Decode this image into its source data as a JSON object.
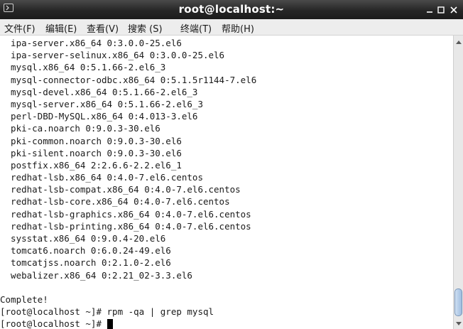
{
  "window": {
    "title": "root@localhost:~",
    "buttons": [
      "minimize",
      "maximize",
      "close"
    ]
  },
  "menu": [
    {
      "label": "文件(F)",
      "name": "menu-file"
    },
    {
      "label": "编辑(E)",
      "name": "menu-edit"
    },
    {
      "label": "查看(V)",
      "name": "menu-view"
    },
    {
      "label": "搜索 (S)",
      "name": "menu-search"
    },
    {
      "label": "终端(T)",
      "name": "menu-terminal"
    },
    {
      "label": "帮助(H)",
      "name": "menu-help"
    }
  ],
  "terminal": {
    "lines": [
      "  ipa-server.x86_64 0:3.0.0-25.el6",
      "  ipa-server-selinux.x86_64 0:3.0.0-25.el6",
      "  mysql.x86_64 0:5.1.66-2.el6_3",
      "  mysql-connector-odbc.x86_64 0:5.1.5r1144-7.el6",
      "  mysql-devel.x86_64 0:5.1.66-2.el6_3",
      "  mysql-server.x86_64 0:5.1.66-2.el6_3",
      "  perl-DBD-MySQL.x86_64 0:4.013-3.el6",
      "  pki-ca.noarch 0:9.0.3-30.el6",
      "  pki-common.noarch 0:9.0.3-30.el6",
      "  pki-silent.noarch 0:9.0.3-30.el6",
      "  postfix.x86_64 2:2.6.6-2.2.el6_1",
      "  redhat-lsb.x86_64 0:4.0-7.el6.centos",
      "  redhat-lsb-compat.x86_64 0:4.0-7.el6.centos",
      "  redhat-lsb-core.x86_64 0:4.0-7.el6.centos",
      "  redhat-lsb-graphics.x86_64 0:4.0-7.el6.centos",
      "  redhat-lsb-printing.x86_64 0:4.0-7.el6.centos",
      "  sysstat.x86_64 0:9.0.4-20.el6",
      "  tomcat6.noarch 0:6.0.24-49.el6",
      "  tomcatjss.noarch 0:2.1.0-2.el6",
      "  webalizer.x86_64 0:2.21_02-3.3.el6",
      "",
      "Complete!",
      "[root@localhost ~]# rpm -qa | grep mysql"
    ],
    "prompt": "[root@localhost ~]# "
  },
  "colors": {
    "titlebar": "#262626",
    "menubar": "#ededed",
    "terminal_bg": "#ffffff",
    "terminal_fg": "#1a1a1a",
    "scroll_thumb": "#9fbde0"
  },
  "icons": {
    "app": "terminal-icon",
    "minimize": "minimize-icon",
    "maximize": "maximize-icon",
    "close": "close-icon",
    "scroll_up": "scroll-up-arrow-icon",
    "scroll_down": "scroll-down-arrow-icon"
  },
  "scrollbar": {
    "position_fraction": 0.95
  }
}
